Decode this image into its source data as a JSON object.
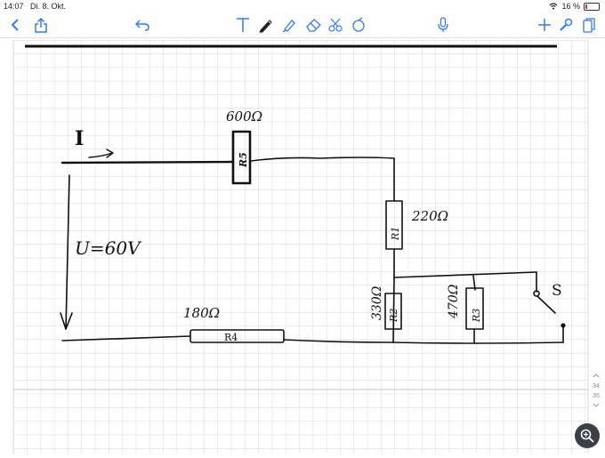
{
  "status_bar": {
    "time": "14:07",
    "date": "Di. 8. Okt.",
    "battery": "16 %",
    "battery_level": 0.16
  },
  "toolbar": {
    "left_icons": [
      "back-icon",
      "share-icon",
      "undo-icon"
    ],
    "tools": [
      "text-tool-icon",
      "pen-tool-icon",
      "highlighter-tool-icon",
      "eraser-tool-icon",
      "lasso-tool-icon",
      "image-tool-icon"
    ],
    "right_icons": [
      "microphone-icon",
      "add-icon",
      "settings-icon",
      "pages-icon"
    ],
    "accent_color": "#2f7bf5"
  },
  "sketch": {
    "current_label": "I",
    "voltage_label": "U=60V",
    "resistor_top_value": "600Ω",
    "resistor_top_label": "R5",
    "r1_label": "R1",
    "r1_value": "220Ω",
    "r2_label": "R2",
    "r2_value": "330Ω",
    "r3_label": "R3",
    "r3_value": "470Ω",
    "r4_label": "R4",
    "r4_value": "180Ω",
    "switch_label": "S"
  },
  "page_indicator": {
    "pages": [
      "34",
      "35"
    ]
  }
}
